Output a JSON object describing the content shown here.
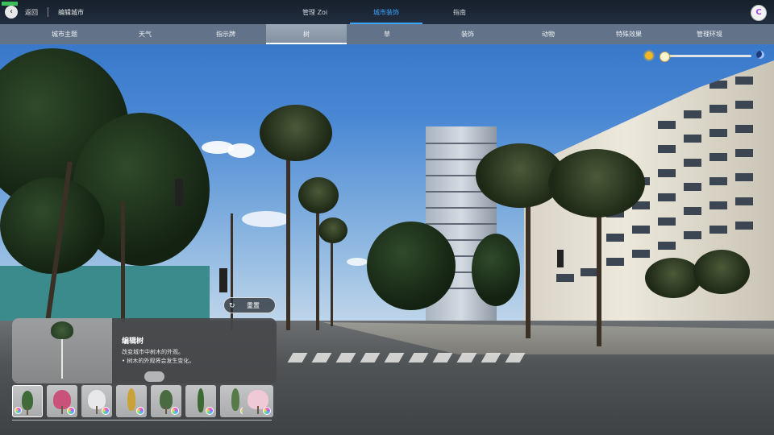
{
  "topbar": {
    "back_label": "返回",
    "page_title": "编辑城市",
    "tabs": [
      {
        "label": "管理 Zoi",
        "active": false
      },
      {
        "label": "城市装饰",
        "active": true
      },
      {
        "label": "指南",
        "active": false
      }
    ],
    "profile_initial": "C",
    "accent_color": "#3aa6ff"
  },
  "categories": [
    {
      "label": "城市主题",
      "active": false
    },
    {
      "label": "天气",
      "active": false
    },
    {
      "label": "指示牌",
      "active": false
    },
    {
      "label": "树",
      "active": true
    },
    {
      "label": "草",
      "active": false
    },
    {
      "label": "装饰",
      "active": false
    },
    {
      "label": "动物",
      "active": false
    },
    {
      "label": "特殊效果",
      "active": false
    },
    {
      "label": "管理环境",
      "active": false
    }
  ],
  "time_slider": {
    "start_icon": "sun-icon",
    "end_icon": "moon-icon",
    "value": 0.05
  },
  "reset_button": {
    "label": "重置",
    "icon": "reset-icon"
  },
  "info_panel": {
    "title": "编辑树",
    "description": "改变城市中树木的外观。",
    "note": "• 树木的外观将会发生变化。"
  },
  "thumbnails": [
    {
      "name": "tree-variant-palm",
      "color": "#3f6a3a",
      "selected": true
    },
    {
      "name": "tree-variant-pink-blossom",
      "color": "#c9517a",
      "selected": false
    },
    {
      "name": "tree-variant-white-bare",
      "color": "#e8e8ea",
      "selected": false
    },
    {
      "name": "tree-variant-yellow-cypress",
      "color": "#c9a238",
      "selected": false
    },
    {
      "name": "tree-variant-pine",
      "color": "#4a6b3f",
      "selected": false
    },
    {
      "name": "tree-variant-cypress",
      "color": "#3d6a34",
      "selected": false
    },
    {
      "name": "tree-variant-slim-pine",
      "color": "#567a48",
      "selected": false
    },
    {
      "name": "tree-variant-cherry",
      "color": "#f0c9d6",
      "selected": false
    }
  ]
}
